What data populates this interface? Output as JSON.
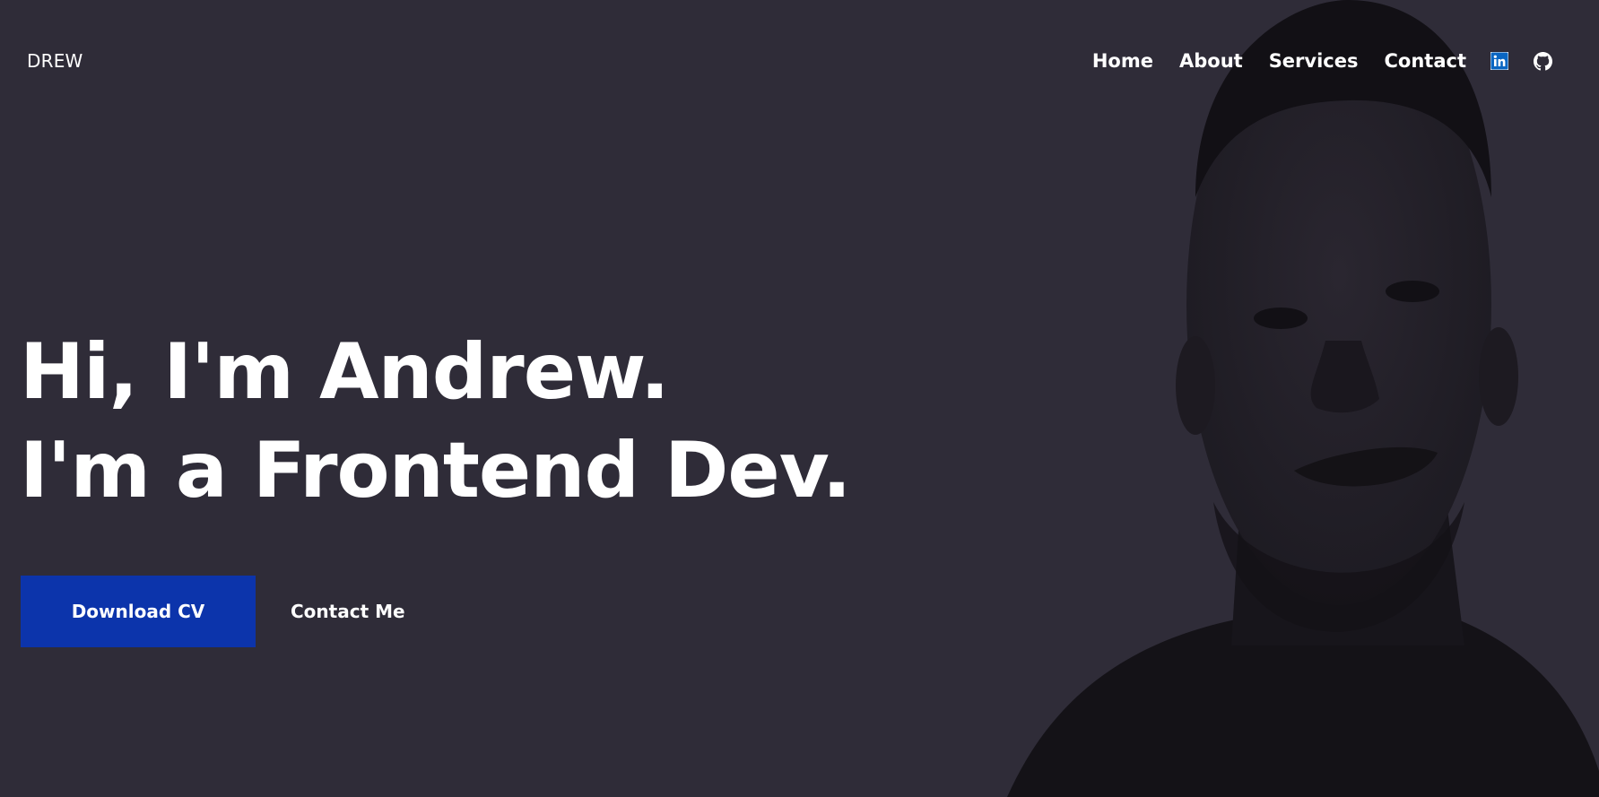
{
  "header": {
    "logo": "DREW",
    "nav": [
      {
        "label": "Home"
      },
      {
        "label": "About"
      },
      {
        "label": "Services"
      },
      {
        "label": "Contact"
      }
    ],
    "social": [
      {
        "icon": "linkedin-icon",
        "color": "#0a66c2"
      },
      {
        "icon": "github-icon",
        "color": "#ffffff"
      }
    ]
  },
  "hero": {
    "line1": "Hi, I'm Andrew.",
    "line2": "I'm a Frontend Dev.",
    "primary_button": "Download CV",
    "secondary_button": "Contact Me"
  },
  "colors": {
    "background": "#2f2c38",
    "accent": "#0c34ab",
    "text": "#ffffff"
  }
}
